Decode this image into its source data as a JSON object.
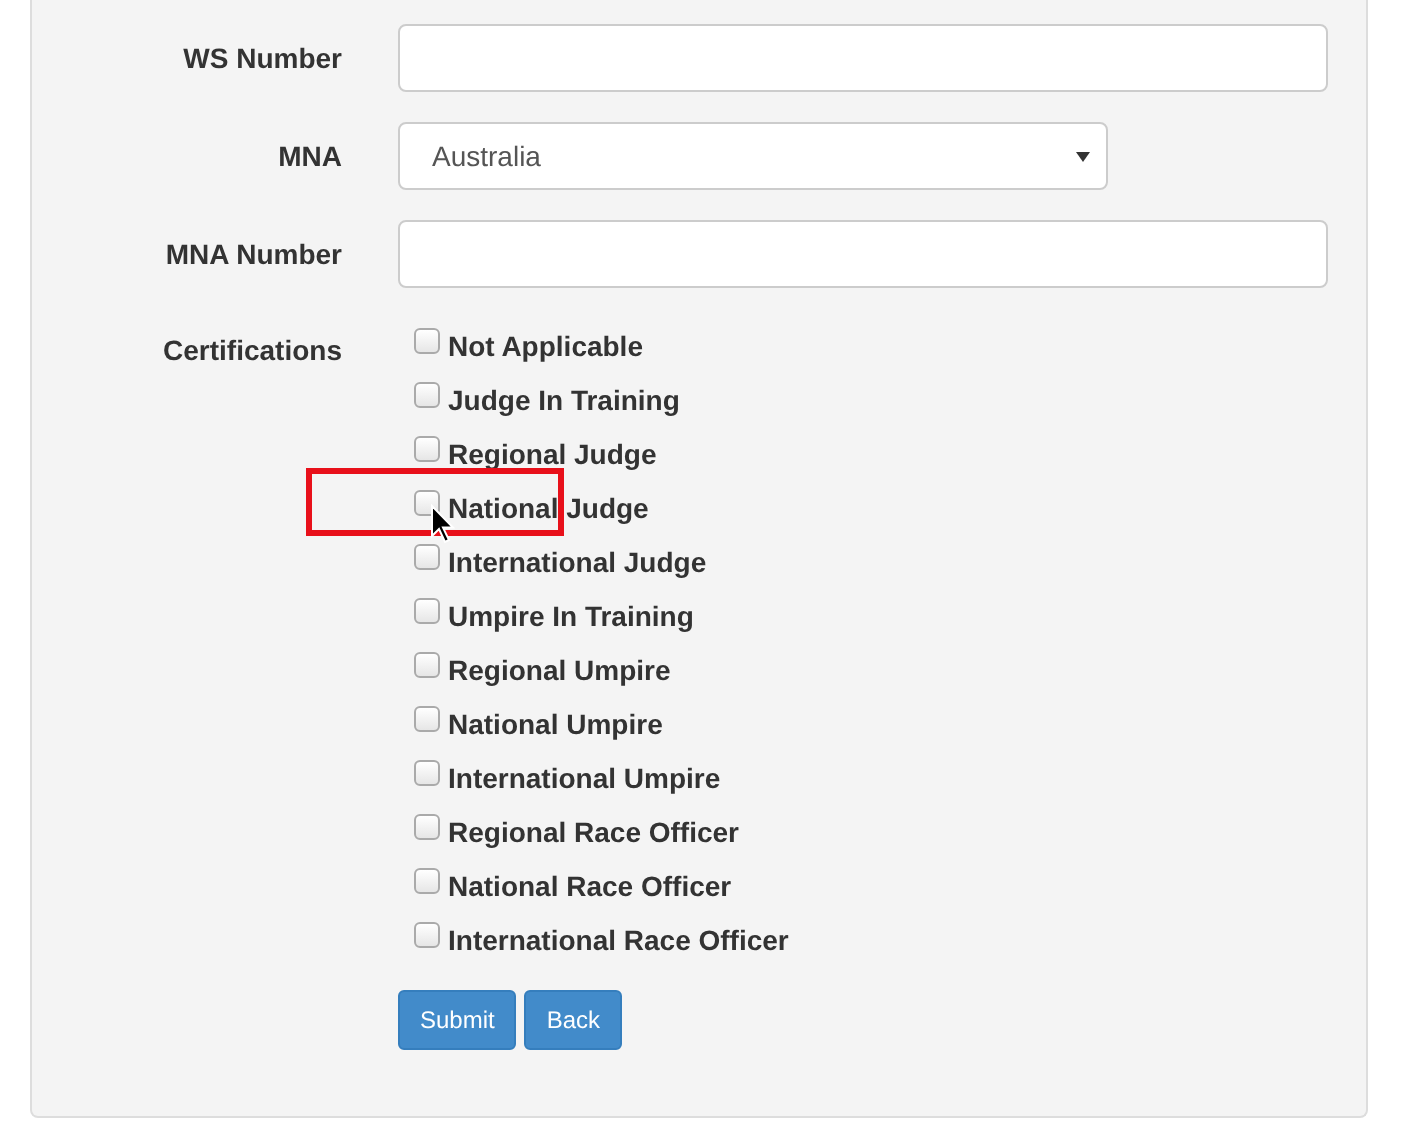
{
  "fields": [
    {
      "kind": "text",
      "label": "WS Number"
    },
    {
      "kind": "select",
      "label": "MNA",
      "value": "Australia"
    },
    {
      "kind": "text",
      "label": "MNA Number"
    }
  ],
  "certifications": {
    "label": "Certifications",
    "options": [
      {
        "label": "Not Applicable",
        "checked": false
      },
      {
        "label": "Judge In Training",
        "checked": false
      },
      {
        "label": "Regional Judge",
        "checked": false
      },
      {
        "label": "National Judge",
        "checked": false
      },
      {
        "label": "International Judge",
        "checked": false
      },
      {
        "label": "Umpire In Training",
        "checked": false
      },
      {
        "label": "Regional Umpire",
        "checked": false
      },
      {
        "label": "National Umpire",
        "checked": false
      },
      {
        "label": "International Umpire",
        "checked": false
      },
      {
        "label": "Regional Race Officer",
        "checked": false
      },
      {
        "label": "National Race Officer",
        "checked": false
      },
      {
        "label": "International Race Officer",
        "checked": false
      }
    ]
  },
  "buttons": [
    {
      "label": "Submit"
    },
    {
      "label": "Back"
    }
  ]
}
